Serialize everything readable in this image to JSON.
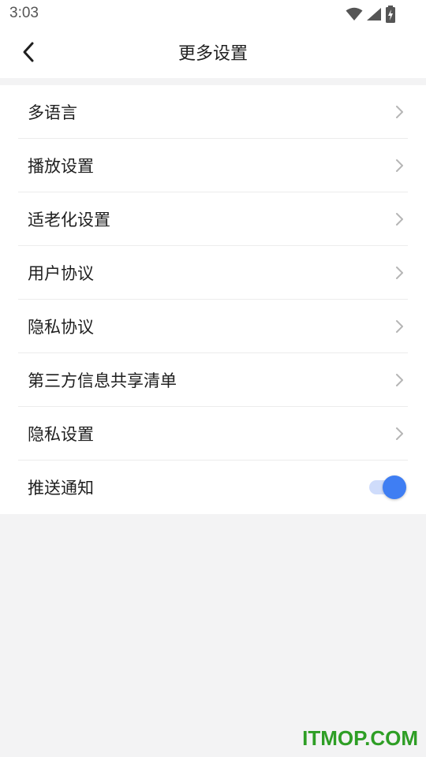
{
  "status_bar": {
    "time": "3:03",
    "icons": [
      "wifi-icon",
      "signal-icon",
      "battery-charging-icon"
    ]
  },
  "nav": {
    "back_icon": "chevron-left-icon",
    "title": "更多设置"
  },
  "settings": {
    "items": [
      {
        "label": "多语言",
        "control": "chevron"
      },
      {
        "label": "播放设置",
        "control": "chevron"
      },
      {
        "label": "适老化设置",
        "control": "chevron"
      },
      {
        "label": "用户协议",
        "control": "chevron"
      },
      {
        "label": "隐私协议",
        "control": "chevron"
      },
      {
        "label": "第三方信息共享清单",
        "control": "chevron"
      },
      {
        "label": "隐私设置",
        "control": "chevron"
      },
      {
        "label": "推送通知",
        "control": "toggle",
        "toggle_on": true
      }
    ]
  },
  "watermark": "ITMOP.COM",
  "colors": {
    "accent": "#3f7ef3",
    "toggle_track": "#cfdcfb",
    "background": "#f3f3f4",
    "watermark": "#2e9e25"
  }
}
